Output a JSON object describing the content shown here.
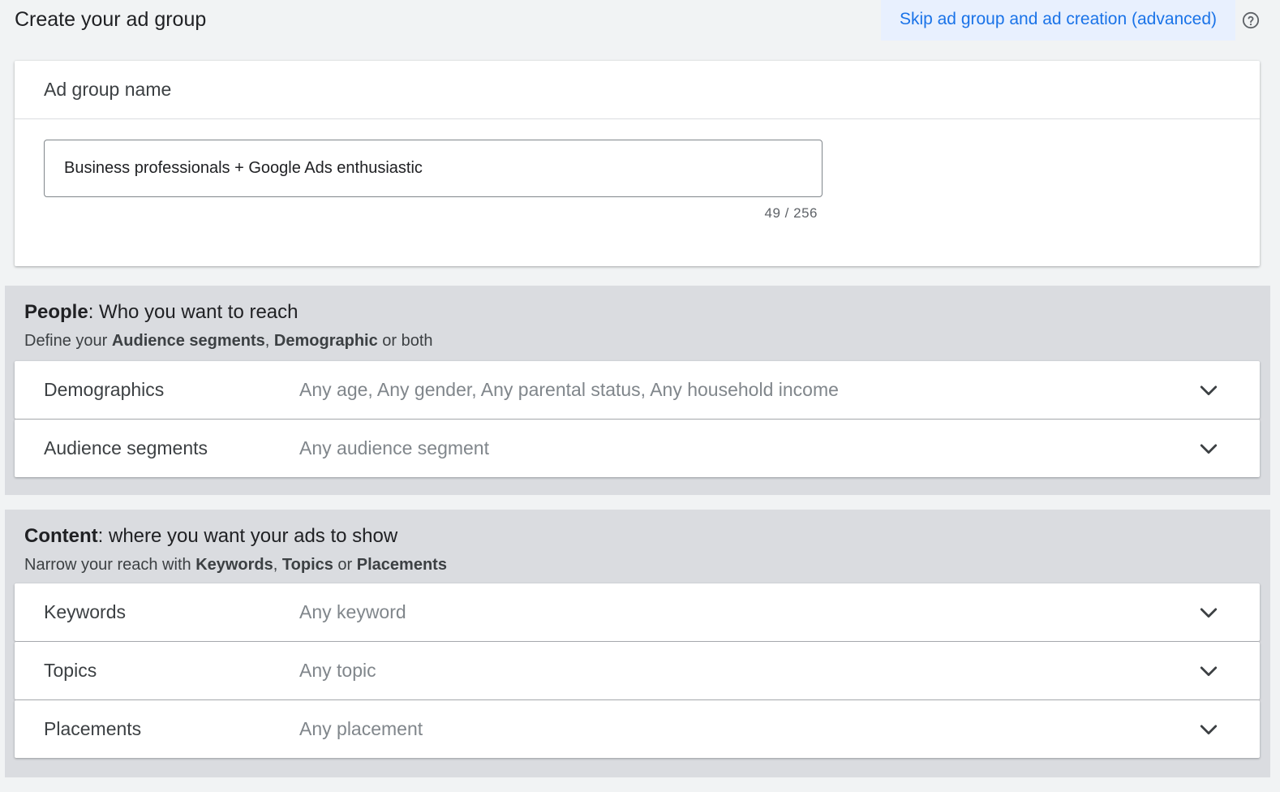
{
  "header": {
    "title": "Create your ad group",
    "skip_link": "Skip ad group and ad creation (advanced)",
    "help_icon": "help-circle-icon"
  },
  "ad_group_name": {
    "title": "Ad group name",
    "value": "Business professionals + Google Ads enthusiastic",
    "counter": "49 / 256"
  },
  "people": {
    "heading_bold": "People",
    "heading_rest": ": Who you want to reach",
    "sub_prefix": "Define your ",
    "sub_bold_1": "Audience segments",
    "sub_sep": ", ",
    "sub_bold_2": "Demographic",
    "sub_suffix": " or both",
    "rows": [
      {
        "label": "Demographics",
        "value": "Any age, Any gender, Any parental status, Any household income"
      },
      {
        "label": "Audience segments",
        "value": "Any audience segment"
      }
    ]
  },
  "content": {
    "heading_bold": "Content",
    "heading_rest": ": where you want your ads to show",
    "sub_prefix": "Narrow your reach with ",
    "sub_bold_1": "Keywords",
    "sub_sep": ", ",
    "sub_bold_2": "Topics",
    "sub_mid": " or ",
    "sub_bold_3": "Placements",
    "rows": [
      {
        "label": "Keywords",
        "value": "Any keyword"
      },
      {
        "label": "Topics",
        "value": "Any topic"
      },
      {
        "label": "Placements",
        "value": "Any placement"
      }
    ]
  },
  "colors": {
    "accent": "#1a73e8",
    "section_bg": "#dadce0",
    "page_bg": "#f1f3f4"
  },
  "icons": {
    "chevron": "chevron-down-icon"
  }
}
